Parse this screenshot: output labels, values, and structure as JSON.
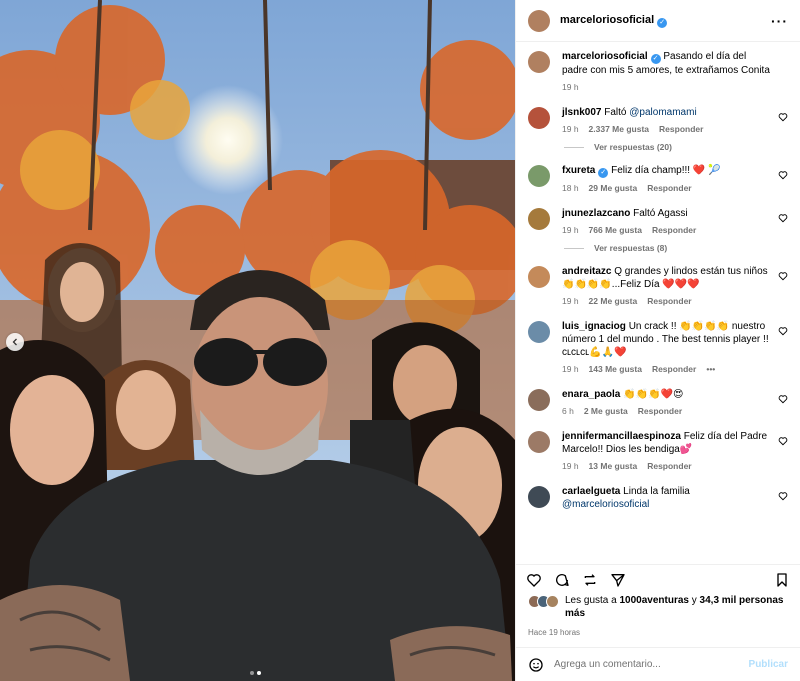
{
  "post": {
    "username": "marceloriosoficial",
    "verified": true,
    "caption": "Pasando el día del padre con mis 5 amores, te extrañamos Conita",
    "caption_time": "19 h"
  },
  "carousel": {
    "dots": 2,
    "active": 1
  },
  "comments": [
    {
      "user": "jlsnk007",
      "verified": false,
      "text": "Faltó ",
      "mention": "@palomamami",
      "time": "19 h",
      "likes": "2.337 Me gusta",
      "reply": "Responder",
      "replies": "Ver respuestas (20)",
      "avatar_color": "#b5523b"
    },
    {
      "user": "fxureta",
      "verified": true,
      "text": "Feliz día champ!!! ❤️ 🎾",
      "time": "18 h",
      "likes": "29 Me gusta",
      "reply": "Responder",
      "avatar_color": "#7a9a6a"
    },
    {
      "user": "jnunezlazcano",
      "verified": false,
      "text": "Faltó Agassi",
      "time": "19 h",
      "likes": "766 Me gusta",
      "reply": "Responder",
      "replies": "Ver respuestas (8)",
      "avatar_color": "#a57a3c"
    },
    {
      "user": "andreitazc",
      "verified": false,
      "text": "Q grandes y lindos están tus niños 👏👏👏👏...Feliz Día ❤️❤️❤️",
      "time": "19 h",
      "likes": "22 Me gusta",
      "reply": "Responder",
      "avatar_color": "#c48a5a"
    },
    {
      "user": "luis_ignaciog",
      "verified": false,
      "text": "Un crack !! 👏👏👏👏 nuestro número 1 del mundo . The best tennis player !! ᴄʟᴄʟᴄʟ💪🙏❤️",
      "time": "19 h",
      "likes": "143 Me gusta",
      "reply": "Responder",
      "options": "•••",
      "avatar_color": "#6b8ca8"
    },
    {
      "user": "enara_paola",
      "verified": false,
      "text": "👏👏👏❤️😍",
      "time": "6 h",
      "likes": "2 Me gusta",
      "reply": "Responder",
      "avatar_color": "#8a6d5b"
    },
    {
      "user": "jennifermancillaespinoza",
      "verified": false,
      "text": "Feliz día del Padre Marcelo!! Dios les bendiga💕",
      "time": "19 h",
      "likes": "13 Me gusta",
      "reply": "Responder",
      "avatar_color": "#9c7a66"
    },
    {
      "user": "carlaelgueta",
      "verified": false,
      "text": "Linda la familia ",
      "mention": "@marceloriosoficial",
      "avatar_color": "#3f4a55"
    }
  ],
  "likes_line": {
    "prefix": "Les gusta a ",
    "user": "1000aventuras",
    "middle": " y ",
    "count": "34,3 mil personas más"
  },
  "time_ago": "Hace 19 horas",
  "composer": {
    "placeholder": "Agrega un comentario...",
    "publish": "Publicar"
  },
  "icons": [
    "more-options-icon",
    "heart-icon",
    "comment-icon",
    "repost-icon",
    "share-icon",
    "bookmark-icon",
    "emoji-icon",
    "chevron-left-icon"
  ]
}
